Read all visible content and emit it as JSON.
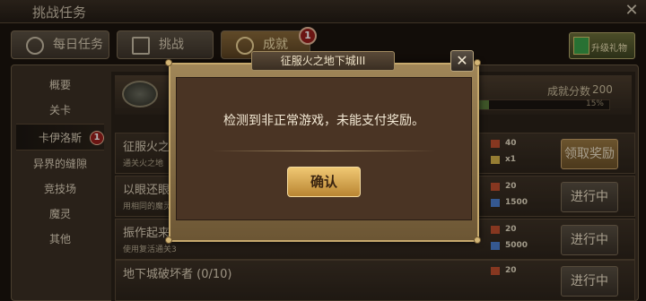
{
  "window": {
    "title": "挑战任务"
  },
  "tabs": [
    {
      "label": "每日任务",
      "icon": "check-icon"
    },
    {
      "label": "挑战",
      "icon": "grid-icon"
    },
    {
      "label": "成就",
      "icon": "trophy-icon",
      "badge": "1"
    }
  ],
  "gift_button": {
    "label": "升级礼物",
    "icon": "gift-icon"
  },
  "sidebar": {
    "items": [
      {
        "label": "概要"
      },
      {
        "label": "关卡"
      },
      {
        "label": "卡伊洛斯",
        "badge": "1",
        "active": true
      },
      {
        "label": "异界的缝隙"
      },
      {
        "label": "竞技场"
      },
      {
        "label": "魔灵"
      },
      {
        "label": "其他"
      }
    ]
  },
  "header": {
    "score_label": "成就分数",
    "score_value": "200",
    "progress_text": "15%",
    "progress_value": 15
  },
  "tasks": [
    {
      "name": "征服火之地",
      "desc": "通关火之地",
      "reward1": "40",
      "reward2": "x1",
      "button": "领取奖励"
    },
    {
      "name": "以眼还眼",
      "desc": "用相同的魔灵",
      "reward1": "20",
      "reward2": "1500",
      "button": "进行中"
    },
    {
      "name": "振作起来 (1",
      "desc": "使用复活通关3",
      "reward1": "20",
      "reward2": "5000",
      "button": "进行中"
    },
    {
      "name": "地下城破坏者 (0/10)",
      "desc": "",
      "reward1": "20",
      "reward2": "",
      "button": "进行中"
    }
  ],
  "dialog": {
    "title": "征服火之地下城III",
    "message": "检测到非正常游戏，未能支付奖励。",
    "confirm": "确认",
    "close": "✕"
  }
}
